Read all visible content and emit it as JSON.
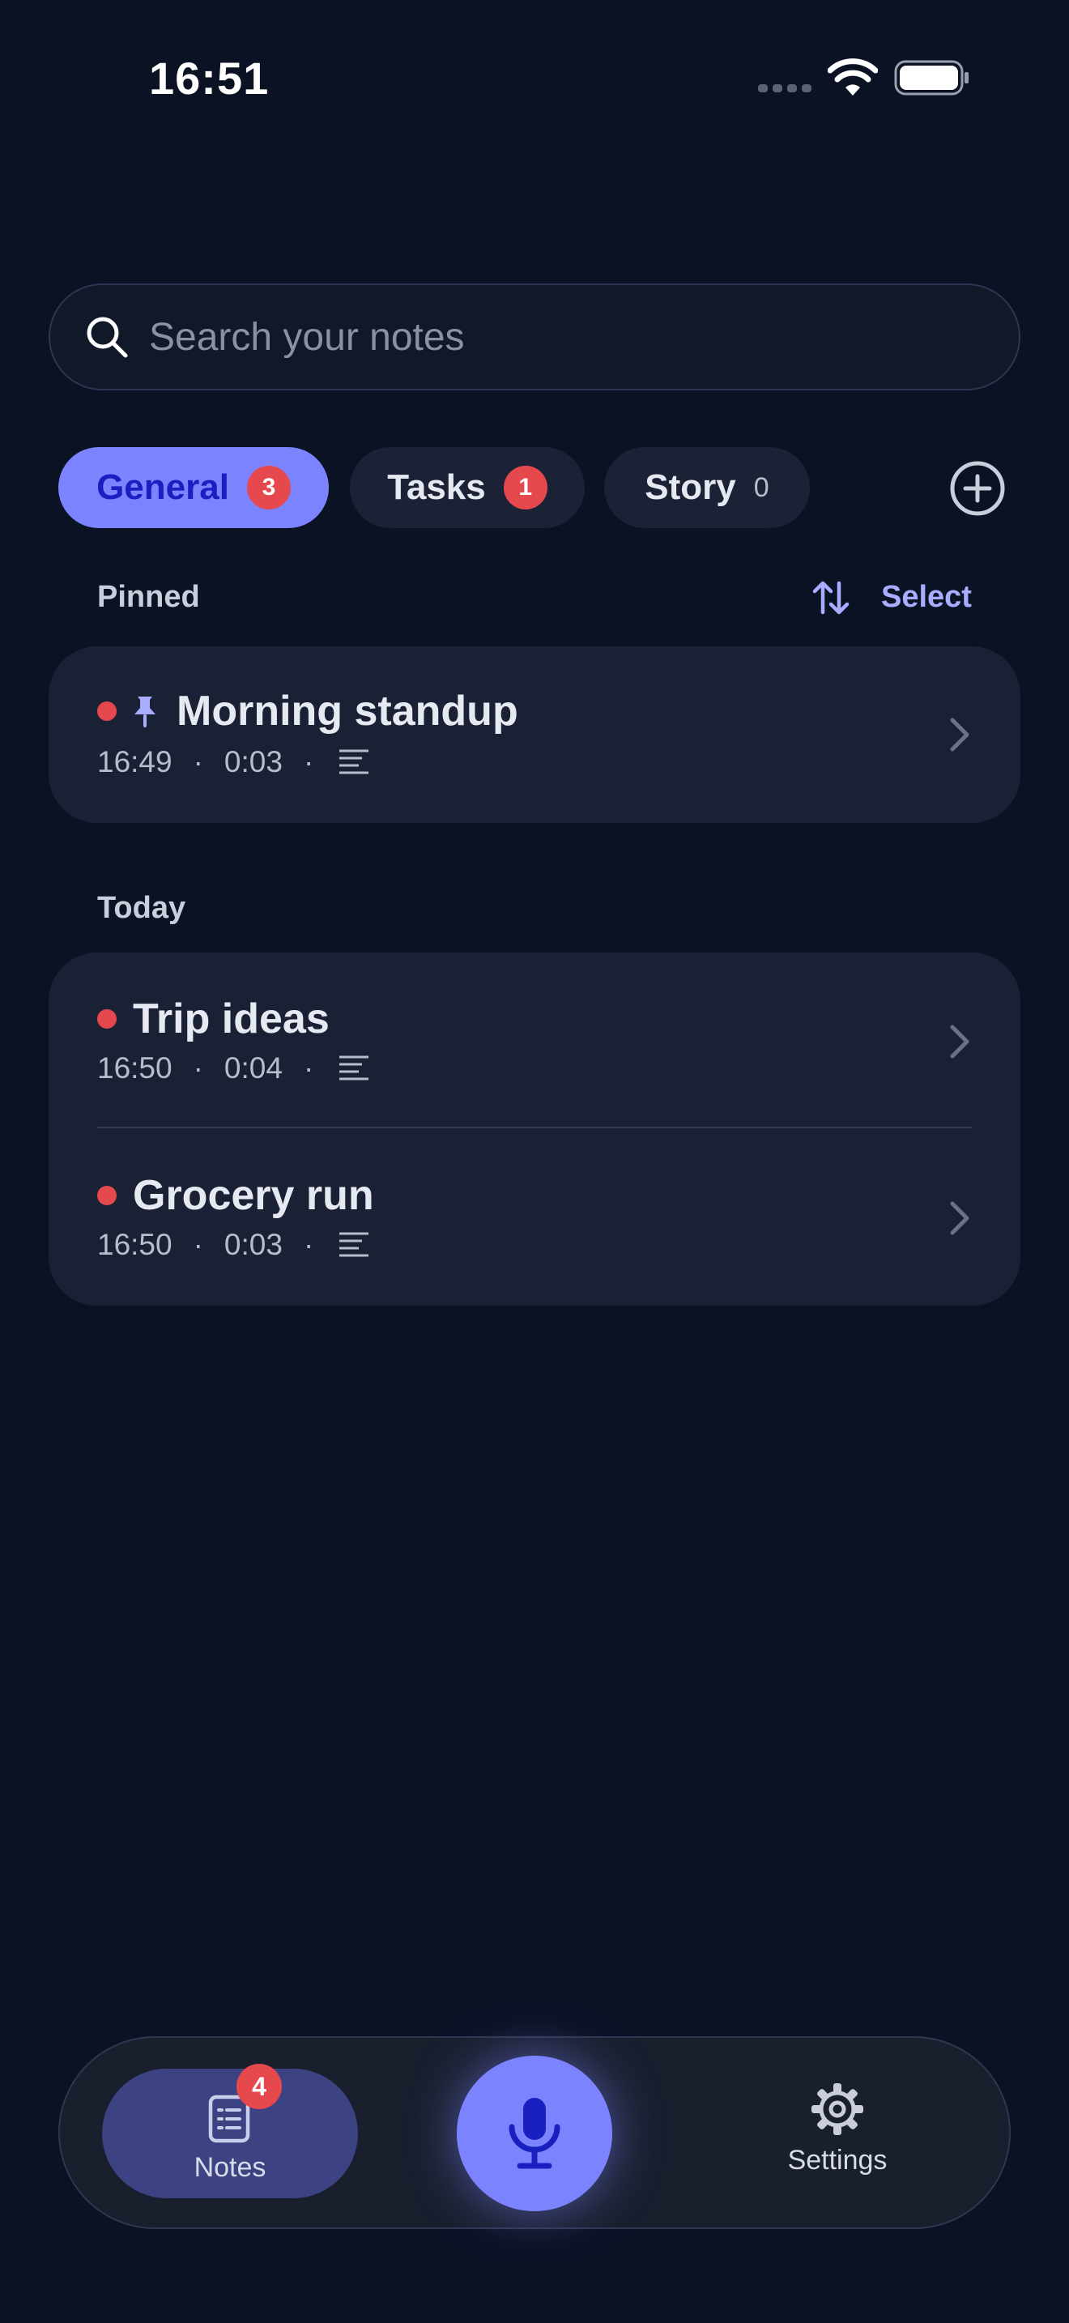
{
  "status_bar": {
    "time": "16:51"
  },
  "search": {
    "placeholder": "Search your notes"
  },
  "categories": [
    {
      "label": "General",
      "count": "3"
    },
    {
      "label": "Tasks",
      "count": "1"
    },
    {
      "label": "Story",
      "count": "0"
    }
  ],
  "sections": {
    "pinned": {
      "label": "Pinned",
      "select_label": "Select",
      "notes": [
        {
          "title": "Morning standup",
          "time": "16:49",
          "duration": "0:03"
        }
      ]
    },
    "today": {
      "label": "Today",
      "notes": [
        {
          "title": "Trip ideas",
          "time": "16:50",
          "duration": "0:04"
        },
        {
          "title": "Grocery run",
          "time": "16:50",
          "duration": "0:03"
        }
      ]
    }
  },
  "meta_separator": "·",
  "bottom_nav": {
    "notes_label": "Notes",
    "notes_badge": "4",
    "settings_label": "Settings"
  },
  "colors": {
    "background": "#0b1224",
    "accent": "#7c83ff",
    "card": "#1a2134",
    "badge_red": "#e5484d"
  }
}
